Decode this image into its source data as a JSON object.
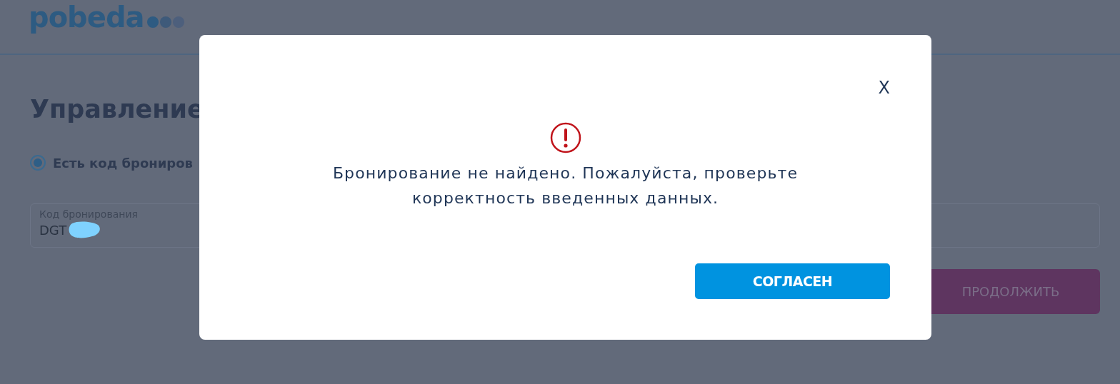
{
  "header": {
    "logo": "pobeda"
  },
  "form": {
    "title": "Управление",
    "options": [
      {
        "label": "Есть код брониров",
        "selected": true
      }
    ],
    "field": {
      "label": "Код бронирования",
      "value": "DGT"
    },
    "continue_button": "ПРОДОЛЖИТЬ"
  },
  "dialog": {
    "close": "X",
    "message": "Бронирование не найдено. Пожалуйста, проверьте корректность введенных данных.",
    "button": "СОГЛАСЕН"
  }
}
